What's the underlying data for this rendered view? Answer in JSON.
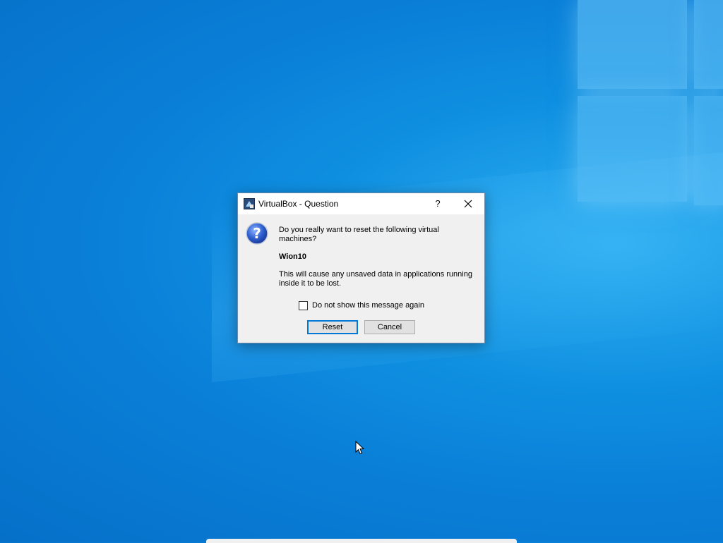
{
  "dialog": {
    "title": "VirtualBox - Question",
    "help_label": "?",
    "message_line1": "Do you really want to reset the following virtual machines?",
    "vm_name": "Wion10",
    "message_line2": "This will cause any unsaved data in applications running inside it to be lost.",
    "checkbox_label": "Do not show this message again",
    "checkbox_checked": false,
    "reset_label": "Reset",
    "cancel_label": "Cancel"
  },
  "icons": {
    "title_icon": "virtualbox-icon",
    "message_icon": "question-icon",
    "close": "close-icon"
  },
  "colors": {
    "desktop": "#0a7fd8",
    "default_button_border": "#0078d7"
  }
}
